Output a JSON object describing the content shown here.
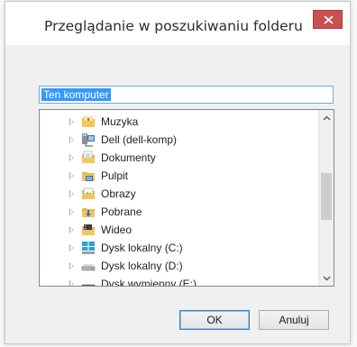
{
  "window": {
    "title": "Przeglądanie w poszukiwaniu folderu",
    "close_icon": "close-icon"
  },
  "folder_field": {
    "value": "Ten komputer"
  },
  "tree": {
    "items": [
      {
        "label": "Muzyka",
        "icon": "music-folder-icon"
      },
      {
        "label": "Dell (dell-komp)",
        "icon": "network-computer-icon"
      },
      {
        "label": "Dokumenty",
        "icon": "documents-folder-icon"
      },
      {
        "label": "Pulpit",
        "icon": "desktop-folder-icon"
      },
      {
        "label": "Obrazy",
        "icon": "pictures-folder-icon"
      },
      {
        "label": "Pobrane",
        "icon": "downloads-folder-icon"
      },
      {
        "label": "Wideo",
        "icon": "videos-folder-icon"
      },
      {
        "label": "Dysk lokalny (C:)",
        "icon": "windows-drive-icon"
      },
      {
        "label": "Dysk lokalny (D:)",
        "icon": "hard-drive-icon"
      },
      {
        "label": "Dysk wymienny (E:)",
        "icon": "removable-drive-icon"
      }
    ]
  },
  "buttons": {
    "ok": "OK",
    "cancel": "Anuluj"
  },
  "colors": {
    "close_button": "#c75050",
    "selection": "#3399ff",
    "field_border": "#7aa7d6"
  }
}
